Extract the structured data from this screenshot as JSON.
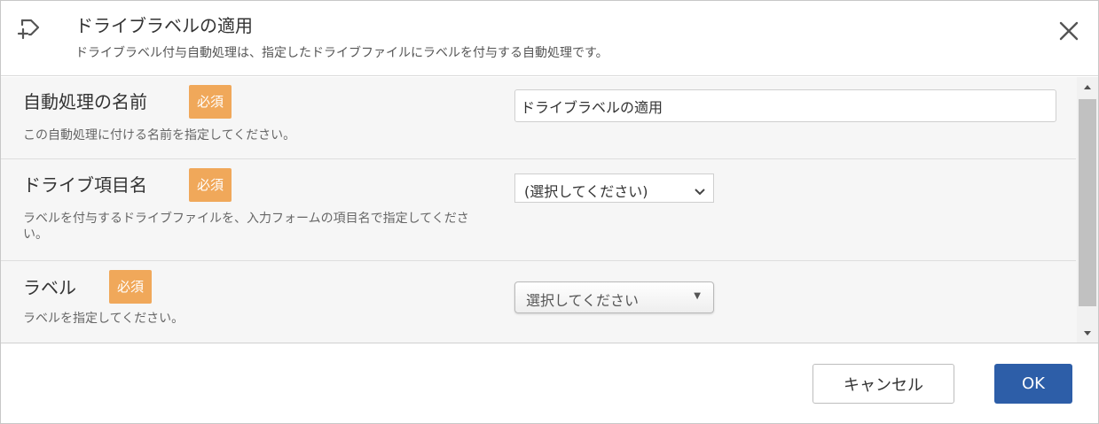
{
  "header": {
    "title": "ドライブラベルの適用",
    "description": "ドライブラベル付与自動処理は、指定したドライブファイルにラベルを付与する自動処理です。",
    "icon": "add-step-icon"
  },
  "fields": [
    {
      "label": "自動処理の名前",
      "badge": "必須",
      "description": "この自動処理に付ける名前を指定してください。",
      "value": "ドライブラベルの適用"
    },
    {
      "label": "ドライブ項目名",
      "badge": "必須",
      "description": "ラベルを付与するドライブファイルを、入力フォームの項目名で指定してください。",
      "selected": "(選択してください)"
    },
    {
      "label": "ラベル",
      "badge": "必須",
      "description": "ラベルを指定してください。",
      "selected": "選択してください"
    }
  ],
  "footer": {
    "cancel_label": "キャンセル",
    "ok_label": "OK"
  },
  "colors": {
    "badge": "#f0a85a",
    "primary": "#2d5ea8",
    "body_bg": "#f6f6f6"
  }
}
